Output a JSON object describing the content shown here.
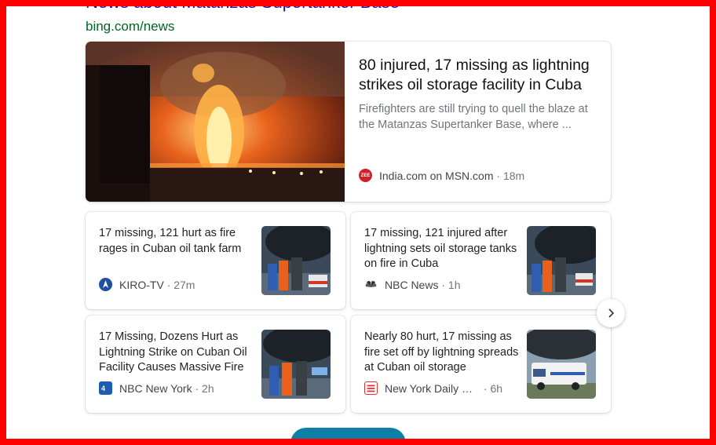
{
  "section": {
    "title": "News about Matanzas Supertanker Base",
    "source_url": "bing.com/news"
  },
  "hero": {
    "title": "80 injured, 17 missing as lightning strikes oil storage facility in Cuba",
    "snippet": "Firefighters are still trying to quell the blaze at the Matanzas Supertanker Base, where ...",
    "logo_text": "ZEE",
    "source": "India.com on MSN.com",
    "time": "18m"
  },
  "cards": [
    {
      "title": "17 missing, 121 hurt as fire rages in Cuban oil tank farm",
      "source": "KIRO-TV",
      "time": "27m",
      "logo_icon": "kiro-logo-icon"
    },
    {
      "title": "17 missing, 121 injured after lightning sets oil storage tanks on fire in Cuba",
      "source": "NBC News",
      "time": "1h",
      "logo_icon": "nbc-peacock-icon"
    },
    {
      "title": "17 Missing, Dozens Hurt as Lightning Strike on Cuban Oil Facility Causes Massive Fire",
      "source": "NBC New York",
      "time": "2h",
      "logo_icon": "nbc-new-york-icon"
    },
    {
      "title": "Nearly 80 hurt, 17 missing as fire set off by lightning spreads at Cuban oil storage",
      "source": "New York Daily News",
      "time": "6h",
      "logo_icon": "daily-news-icon"
    }
  ],
  "separator": "·",
  "navigation": {
    "next_icon": "chevron-right-icon"
  },
  "colors": {
    "frame": "#ff0000",
    "title_link": "#1a0dab",
    "url_green": "#006621",
    "more_button": "#0c7fa6"
  }
}
